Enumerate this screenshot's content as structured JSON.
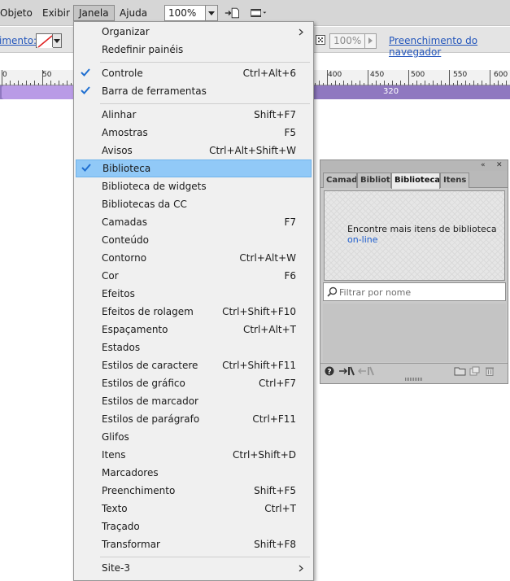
{
  "menubar": {
    "items": [
      {
        "label": "Objeto",
        "active": false
      },
      {
        "label": "Exibir",
        "active": false
      },
      {
        "label": "Janela",
        "active": true
      },
      {
        "label": "Ajuda",
        "active": false
      }
    ],
    "zoom_value": "100%"
  },
  "control_bar": {
    "fill_label": "imento:",
    "opacity_value": "100%",
    "browser_fill_link": "Preenchimento do navegador"
  },
  "ruler": {
    "labels": [
      "0",
      "50",
      "400",
      "450",
      "500",
      "550",
      "600"
    ],
    "slice_width_label": "320"
  },
  "window_menu": {
    "items": [
      {
        "label": "Organizar",
        "shortcut": "",
        "submenu": true
      },
      {
        "label": "Redefinir painéis",
        "shortcut": ""
      },
      {
        "label": "Controle",
        "shortcut": "Ctrl+Alt+6",
        "checked": true
      },
      {
        "label": "Barra de ferramentas",
        "shortcut": "",
        "checked": true
      },
      {
        "label": "Alinhar",
        "shortcut": "Shift+F7"
      },
      {
        "label": "Amostras",
        "shortcut": "F5"
      },
      {
        "label": "Avisos",
        "shortcut": "Ctrl+Alt+Shift+W"
      },
      {
        "label": "Biblioteca",
        "shortcut": "",
        "checked": true,
        "highlighted": true
      },
      {
        "label": "Biblioteca de widgets",
        "shortcut": ""
      },
      {
        "label": "Bibliotecas da CC",
        "shortcut": ""
      },
      {
        "label": "Camadas",
        "shortcut": "F7"
      },
      {
        "label": "Conteúdo",
        "shortcut": ""
      },
      {
        "label": "Contorno",
        "shortcut": "Ctrl+Alt+W"
      },
      {
        "label": "Cor",
        "shortcut": "F6"
      },
      {
        "label": "Efeitos",
        "shortcut": ""
      },
      {
        "label": "Efeitos de rolagem",
        "shortcut": "Ctrl+Shift+F10"
      },
      {
        "label": "Espaçamento",
        "shortcut": "Ctrl+Alt+T"
      },
      {
        "label": "Estados",
        "shortcut": ""
      },
      {
        "label": "Estilos de caractere",
        "shortcut": "Ctrl+Shift+F11"
      },
      {
        "label": "Estilos de gráfico",
        "shortcut": "Ctrl+F7"
      },
      {
        "label": "Estilos de marcador",
        "shortcut": ""
      },
      {
        "label": "Estilos de parágrafo",
        "shortcut": "Ctrl+F11"
      },
      {
        "label": "Glifos",
        "shortcut": ""
      },
      {
        "label": "Itens",
        "shortcut": "Ctrl+Shift+D"
      },
      {
        "label": "Marcadores",
        "shortcut": ""
      },
      {
        "label": "Preenchimento",
        "shortcut": "Shift+F5"
      },
      {
        "label": "Texto",
        "shortcut": "Ctrl+T"
      },
      {
        "label": "Traçado",
        "shortcut": ""
      },
      {
        "label": "Transformar",
        "shortcut": "Shift+F8"
      },
      {
        "label": "Site-3",
        "shortcut": "",
        "submenu": true
      }
    ]
  },
  "library_panel": {
    "tabs": [
      {
        "label": "Camadas",
        "active": false
      },
      {
        "label": "Biblioteca de widgets",
        "active": false
      },
      {
        "label": "Biblioteca",
        "active": true
      },
      {
        "label": "Itens",
        "active": false
      }
    ],
    "message": "Encontre mais itens de biblioteca",
    "online_link": "on-line",
    "filter_placeholder": "Filtrar por nome"
  },
  "colors": {
    "menu_highlight": "#91c9f7",
    "slice_bar": "#8f78c0",
    "link": "#2255bb"
  }
}
